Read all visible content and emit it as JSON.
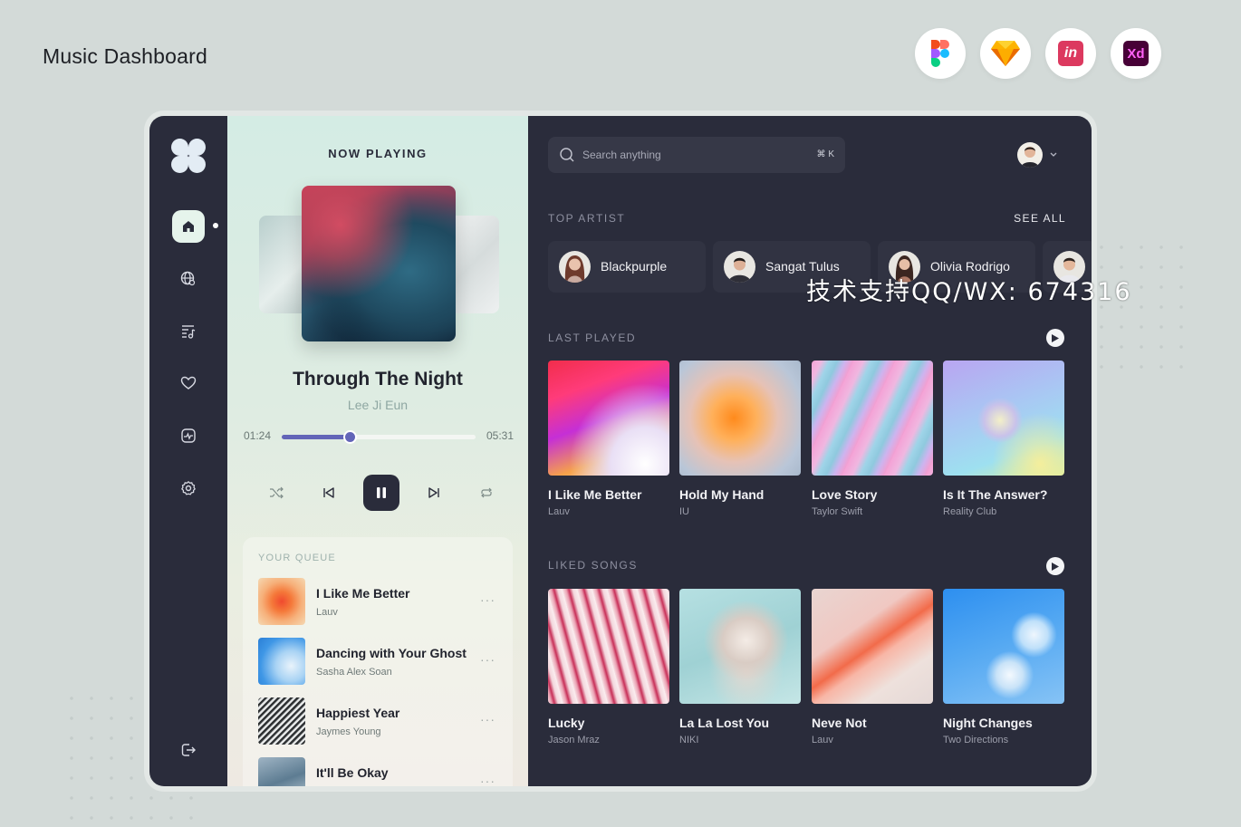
{
  "page_title": "Music Dashboard",
  "tools": [
    {
      "name": "figma-icon"
    },
    {
      "name": "sketch-icon"
    },
    {
      "name": "invision-icon",
      "label": "in"
    },
    {
      "name": "adobe-xd-icon",
      "label": "Xd"
    }
  ],
  "sidebar": {
    "items": [
      "home",
      "explore",
      "playlist",
      "favorites",
      "inbox",
      "settings",
      "logout"
    ]
  },
  "now_playing": {
    "heading": "NOW PLAYING",
    "title": "Through The Night",
    "artist": "Lee Ji Eun",
    "elapsed": "01:24",
    "duration": "05:31",
    "progress": 0.35
  },
  "queue": {
    "label": "YOUR QUEUE",
    "items": [
      {
        "title": "I Like Me Better",
        "artist": "Lauv"
      },
      {
        "title": "Dancing with Your Ghost",
        "artist": "Sasha Alex Soan"
      },
      {
        "title": "Happiest Year",
        "artist": "Jaymes Young"
      },
      {
        "title": "It'll Be Okay",
        "artist": ""
      }
    ],
    "more": "···"
  },
  "search": {
    "placeholder": "Search anything",
    "shortcut": "⌘ K"
  },
  "top_artist": {
    "label": "TOP ARTIST",
    "see_all": "SEE ALL",
    "artists": [
      "Blackpurple",
      "Sangat Tulus",
      "Olivia Rodrigo"
    ]
  },
  "last_played": {
    "label": "LAST PLAYED",
    "cards": [
      {
        "title": "I Like Me Better",
        "artist": "Lauv"
      },
      {
        "title": "Hold My Hand",
        "artist": "IU"
      },
      {
        "title": "Love Story",
        "artist": "Taylor Swift"
      },
      {
        "title": "Is It The Answer?",
        "artist": "Reality Club"
      }
    ]
  },
  "liked_songs": {
    "label": "LIKED SONGS",
    "cards": [
      {
        "title": "Lucky",
        "artist": "Jason Mraz"
      },
      {
        "title": "La La Lost You",
        "artist": "NIKI"
      },
      {
        "title": "Neve Not",
        "artist": "Lauv"
      },
      {
        "title": "Night Changes",
        "artist": "Two Directions"
      }
    ]
  },
  "watermark": "技术支持QQ/WX: 674316",
  "colors": {
    "accent": "#6365b8",
    "dark": "#2a2c3b",
    "active_nav": "#e6f4ec"
  }
}
